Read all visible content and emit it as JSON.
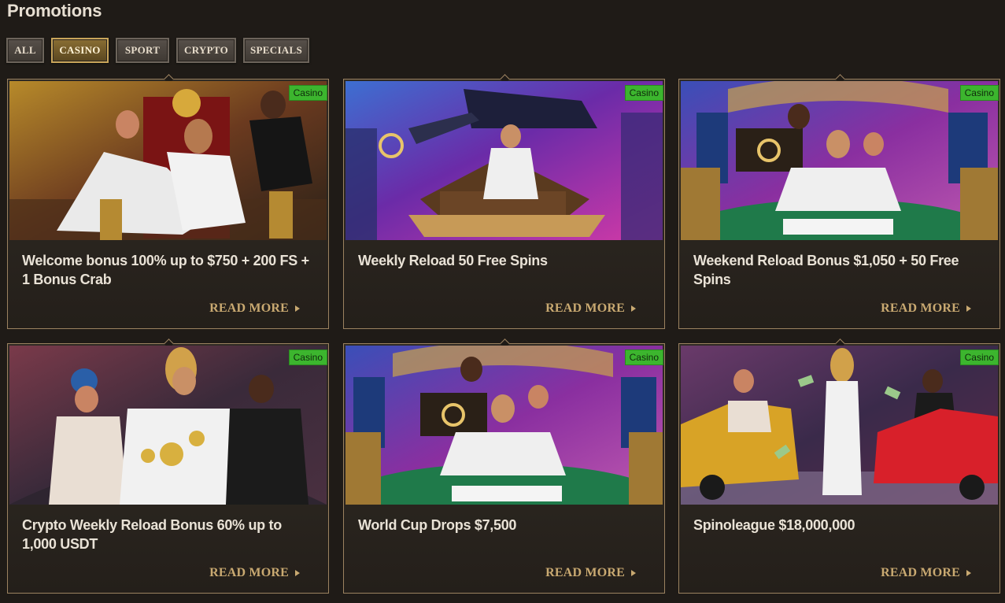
{
  "page": {
    "title": "Promotions"
  },
  "filters": [
    {
      "label": "ALL",
      "active": false
    },
    {
      "label": "CASINO",
      "active": true
    },
    {
      "label": "SPORT",
      "active": false
    },
    {
      "label": "CRYPTO",
      "active": false
    },
    {
      "label": "SPECIALS",
      "active": false
    }
  ],
  "cards": [
    {
      "title": "Welcome bonus 100% up to $750 + 200 FS + 1 Bonus Crab",
      "badge": "Casino",
      "cta": "READ MORE",
      "scene": "throne"
    },
    {
      "title": "Weekly Reload 50 Free Spins",
      "badge": "Casino",
      "cta": "READ MORE",
      "scene": "helicopter"
    },
    {
      "title": "Weekend Reload Bonus $1,050 + 50 Free Spins",
      "badge": "Casino",
      "cta": "READ MORE",
      "scene": "poker"
    },
    {
      "title": "Crypto Weekly Reload Bonus 60% up to 1,000 USDT",
      "badge": "Casino",
      "cta": "READ MORE",
      "scene": "crypto"
    },
    {
      "title": "World Cup Drops $7,500",
      "badge": "Casino",
      "cta": "READ MORE",
      "scene": "poker"
    },
    {
      "title": "Spinoleague $18,000,000",
      "badge": "Casino",
      "cta": "READ MORE",
      "scene": "cars"
    }
  ],
  "colors": {
    "background": "#1f1b17",
    "accent": "#c9a971",
    "badge": "#3cb52e"
  }
}
